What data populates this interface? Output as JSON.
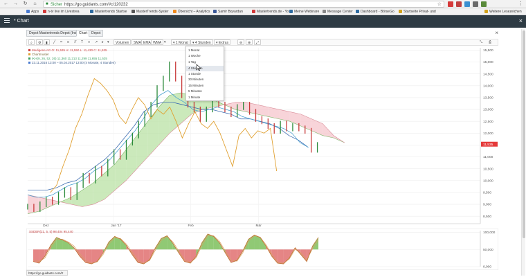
{
  "browser": {
    "secure_label": "Sicher",
    "url": "https://go.guidants.com/#c/120232",
    "bookmarks": [
      {
        "label": "Apps",
        "color": "#4a7bd0"
      },
      {
        "label": "n-tv live im Livestrea",
        "color": "#d23a3a"
      },
      {
        "label": "Mastertrends Startse",
        "color": "#2e6ba0"
      },
      {
        "label": "MasterTrends-Syster",
        "color": "#555555"
      },
      {
        "label": "Übersicht – Analytics",
        "color": "#f08a1c"
      },
      {
        "label": "Samir Boyardan",
        "color": "#3b5998"
      },
      {
        "label": "Mastertrends.de - Yo",
        "color": "#d23a3a"
      },
      {
        "label": "Meine Webinare",
        "color": "#2e6ba0"
      },
      {
        "label": "Message Center",
        "color": "#888888"
      },
      {
        "label": "Dashboard - BörseGo",
        "color": "#2e6ba0"
      },
      {
        "label": "Startseite Privat- und",
        "color": "#d2a21c"
      },
      {
        "label": "Weitere Lesezeichen",
        "color": "#d2a21c"
      }
    ]
  },
  "app": {
    "title": "* Chart",
    "close_glyph": "×"
  },
  "tabs": [
    {
      "label": "Depot Mastertrends Depot (Ind)"
    },
    {
      "label": "Chart"
    },
    {
      "label": "Depot"
    }
  ],
  "toolbar": {
    "volume": "Volumen",
    "sma": "SMA",
    "ema": "EMA",
    "wma": "WMA",
    "period": "1 Monat",
    "interval": "4 Stunden",
    "extras": "Extras"
  },
  "timeframes": [
    "1 Monat",
    "1 Woche",
    "1 Tag",
    "4 Stunden",
    "1 Stunde",
    "30 Minuten",
    "15 Minuten",
    "5 Minuten",
    "1 Minute"
  ],
  "selected_timeframe_index": 3,
  "legend": [
    {
      "text": "Medigene AG  O: 11,535  H: 11,550  L: 11,430  C: 11,535",
      "color": "#d04040"
    },
    {
      "text": "Chartmuster",
      "color": "#e0a030"
    },
    {
      "text": "IKH(9, 26, 52, 26)  11,360  11,213  11,299  11,655  11,535",
      "color": "#3aa060"
    },
    {
      "text": "23.11.2016 13:00 – 05.04.2017 13:00  (4 Monate, 4 Stunden)",
      "color": "#4a7bd0"
    }
  ],
  "oscillator_label": "SSDBR(21, 5, 5)  98,404  95,440",
  "status_url": "https://go.guidants.com/#",
  "colors": {
    "price": "#d04040",
    "chikou": "#e0a030",
    "tenkan": "#4aa0d0",
    "kijun": "#3a6ab0",
    "cloud_bull": "#b9e2a4",
    "cloud_bear": "#f6c6cc",
    "osc_line": "#c07a3a",
    "osc_fill_up": "#7cc05c",
    "osc_fill_down": "#e07070",
    "last_price_tag": "#e53a3a"
  },
  "chart_data": [
    {
      "type": "line",
      "title": "Medigene AG",
      "x_tick_labels": [
        "Dez",
        "Jan '17",
        "Feb",
        "Mär"
      ],
      "y_tick_labels": [
        "15,500",
        "15,000",
        "14,500",
        "14,000",
        "13,500",
        "13,000",
        "12,500",
        "12,000",
        "11,500",
        "11,000",
        "10,500",
        "10,000",
        "9,500",
        "9,000",
        "8,500"
      ],
      "ylim": [
        8.3,
        15.6
      ],
      "last_price_label": "11,535",
      "series": [
        {
          "name": "Medigene AG",
          "role": "price",
          "values": [
            8.9,
            8.8,
            9.0,
            9.2,
            9.1,
            9.4,
            9.6,
            9.3,
            9.8,
            10.2,
            10.0,
            10.5,
            10.3,
            10.8,
            11.2,
            11.0,
            11.6,
            11.9,
            12.4,
            12.8,
            13.2,
            13.9,
            14.3,
            14.9,
            14.3,
            13.6,
            13.2,
            13.0,
            12.6,
            13.0,
            13.4,
            13.2,
            13.0,
            12.8,
            13.1,
            13.2,
            12.9,
            12.6,
            12.5,
            12.3,
            12.1,
            12.4,
            12.2,
            12.3,
            12.2,
            12.1,
            11.3,
            11.5
          ]
        },
        {
          "name": "Chartmuster",
          "role": "chikou",
          "values": [
            9.5,
            9.8,
            10.6,
            11.3,
            12.2,
            12.8,
            13.6,
            14.3,
            14.1,
            13.8,
            13.4,
            12.7,
            12.4,
            13.0,
            13.5,
            13.2,
            12.6,
            13.0,
            12.8,
            13.1,
            12.5,
            11.8,
            12.4,
            12.9,
            12.4,
            12.2,
            12.5,
            12.0,
            11.3,
            10.6,
            11.9,
            12.2,
            11.8,
            12.1,
            12.0,
            12.2,
            10.4
          ]
        },
        {
          "role": "tenkan",
          "values": [
            9.4,
            9.3,
            9.3,
            9.4,
            9.6,
            9.8,
            9.9,
            10.1,
            10.4,
            10.6,
            10.9,
            11.3,
            11.7,
            12.1,
            12.6,
            13.2,
            13.6,
            13.8,
            13.5,
            13.3,
            13.0,
            12.9,
            13.0,
            13.1,
            13.0,
            12.9,
            12.7,
            12.6,
            12.5,
            12.4,
            12.3,
            12.2,
            12.0,
            11.6,
            11.4
          ]
        },
        {
          "role": "kijun",
          "values": [
            9.6,
            9.6,
            9.6,
            9.7,
            9.9,
            10.0,
            10.3,
            10.6,
            10.9,
            11.3,
            11.8,
            12.3,
            12.9,
            13.2,
            13.3,
            13.3,
            13.2,
            13.1,
            13.0,
            13.0,
            12.9,
            12.8,
            12.6,
            12.6,
            12.5,
            12.4,
            12.2,
            11.9,
            11.7,
            11.4
          ]
        },
        {
          "role": "cloud_a",
          "values": [
            8.6,
            8.7,
            8.9,
            9.1,
            9.3,
            9.6,
            9.9,
            10.3,
            10.7,
            11.3,
            11.9,
            12.5,
            13.1,
            13.6,
            13.7,
            13.6,
            13.5,
            13.4,
            13.2,
            13.0,
            12.9,
            12.8,
            12.7,
            12.6,
            12.5,
            12.3,
            12.1,
            11.9,
            11.8,
            11.6
          ]
        },
        {
          "role": "cloud_b",
          "values": [
            9.4,
            9.3,
            9.2,
            9.1,
            9.0,
            8.9,
            9.0,
            9.2,
            9.6,
            10.0,
            10.5,
            11.0,
            11.5,
            12.0,
            12.4,
            12.8,
            13.0,
            13.1,
            13.2,
            13.3,
            13.3,
            13.2,
            13.1,
            13.0,
            12.9,
            12.8,
            12.6,
            12.4,
            11.9,
            11.6
          ]
        }
      ]
    },
    {
      "type": "line",
      "title": "SSDBR(21, 5, 5)",
      "y_tick_labels": [
        "100,000",
        "50,000",
        "0,000"
      ],
      "ylim": [
        0,
        105
      ],
      "reference": 50,
      "series": [
        {
          "name": "SSDBR",
          "values": [
            15,
            10,
            30,
            62,
            85,
            78,
            70,
            55,
            30,
            12,
            8,
            15,
            40,
            72,
            88,
            80,
            62,
            35,
            12,
            8,
            20,
            55,
            82,
            90,
            68,
            40,
            15,
            10,
            30,
            70,
            95,
            88,
            70,
            40,
            12,
            18,
            45,
            80,
            92,
            85,
            60,
            30,
            10,
            8,
            25,
            55,
            35,
            15,
            60,
            85
          ]
        },
        {
          "name": "Signal",
          "values": [
            20,
            15,
            25,
            55,
            80,
            80,
            72,
            60,
            38,
            18,
            10,
            14,
            35,
            66,
            84,
            82,
            66,
            42,
            18,
            10,
            18,
            48,
            76,
            88,
            72,
            46,
            20,
            12,
            26,
            62,
            90,
            90,
            74,
            46,
            18,
            16,
            40,
            74,
            90,
            86,
            64,
            36,
            14,
            10,
            22,
            50,
            40,
            20,
            52,
            78
          ]
        }
      ]
    }
  ]
}
